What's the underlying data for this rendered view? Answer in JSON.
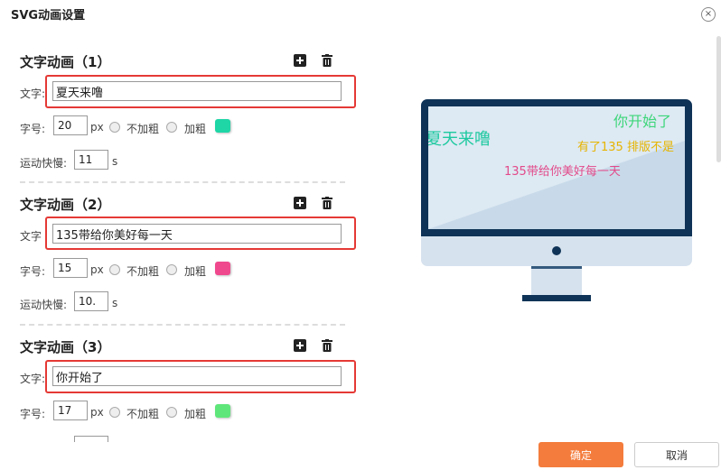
{
  "dialog": {
    "title": "SVG动画设置",
    "close_glyph": "×"
  },
  "labels": {
    "text_label": "文字",
    "colon": ":",
    "size_label": "字号:",
    "px": "px",
    "not_bold": "不加粗",
    "bold": "加粗",
    "speed_label": "运动快慢:",
    "seconds": "s"
  },
  "animations": [
    {
      "title": "文字动画（1）",
      "text": "夏天来噜",
      "size": "20",
      "speed": "11",
      "color": "#1ed6a6"
    },
    {
      "title": "文字动画（2）",
      "text": "135带给你美好每一天",
      "size": "15",
      "speed": "10.",
      "color": "#f0488d"
    },
    {
      "title": "文字动画（3）",
      "text": "你开始了",
      "size": "17",
      "speed": "",
      "color": "#5fe67a"
    }
  ],
  "preview": {
    "lines": [
      {
        "text": "夏天来噜",
        "color": "#1ec9a0"
      },
      {
        "text": "你开始了",
        "color": "#3ed67a"
      },
      {
        "text": "有了135 排版不是",
        "color": "#e6b400"
      },
      {
        "text": "135带给你美好每一天",
        "color": "#e24a8a"
      }
    ]
  },
  "buttons": {
    "ok": "确定",
    "cancel": "取消"
  },
  "colors": {
    "accent": "#f47c3c",
    "highlight": "#e53935",
    "monitor_frame": "#0f3357"
  }
}
